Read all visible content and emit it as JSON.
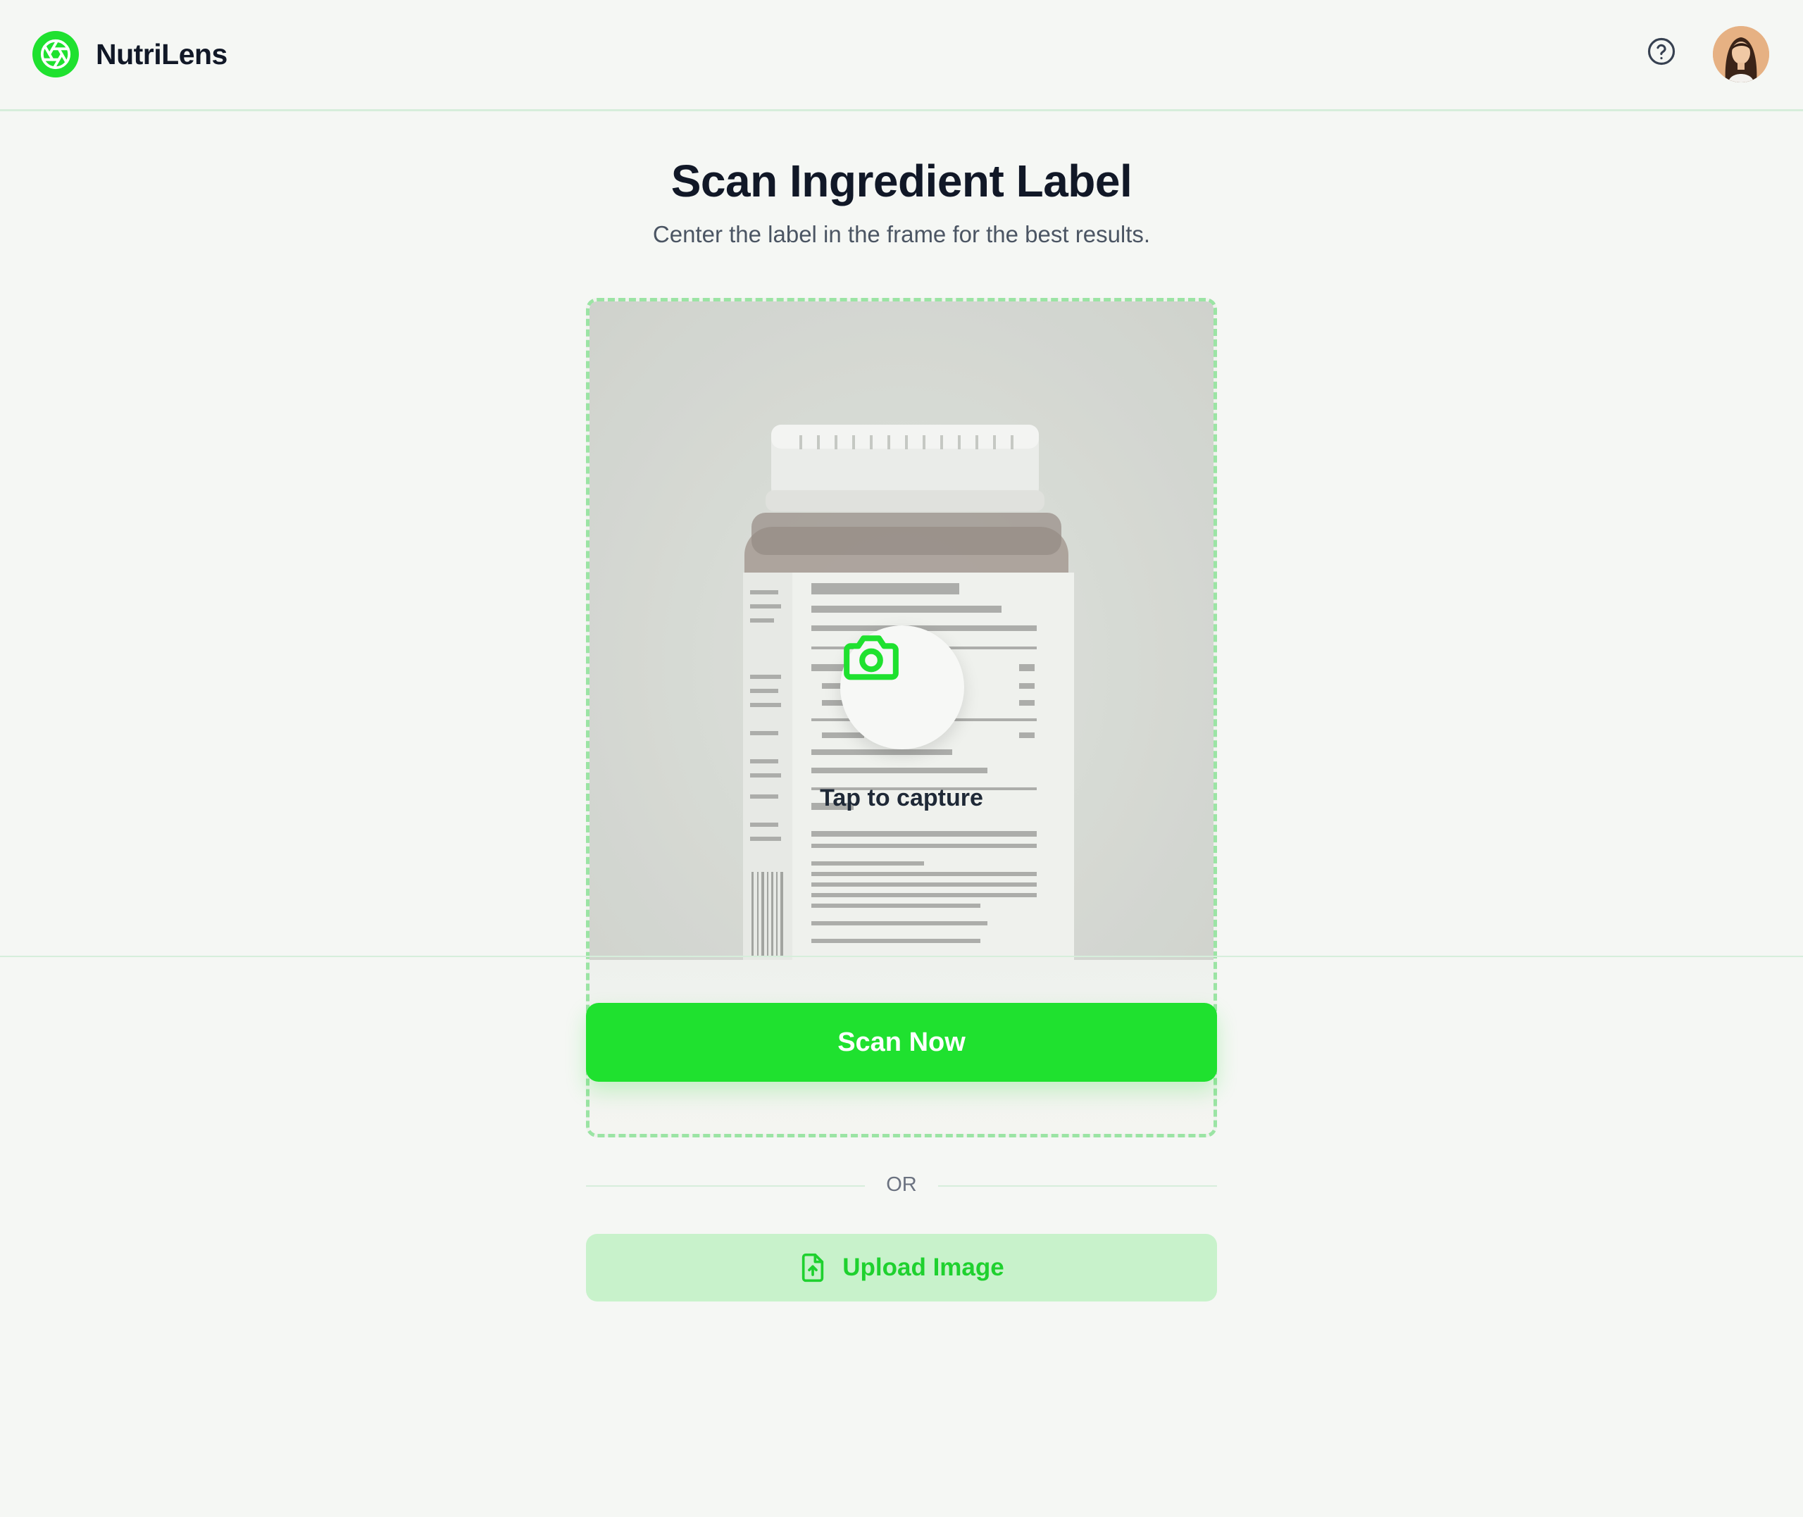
{
  "app": {
    "name": "NutriLens"
  },
  "header": {
    "help_icon": "help-circle-icon",
    "avatar_icon": "user-avatar"
  },
  "main": {
    "title": "Scan Ingredient Label",
    "subtitle": "Center the label in the frame for the best results.",
    "camera": {
      "capture_label": "Tap to capture",
      "capture_icon": "camera-icon"
    },
    "scan_button_label": "Scan Now",
    "divider_text": "OR",
    "upload_button_label": "Upload Image",
    "upload_icon": "file-upload-icon"
  },
  "colors": {
    "accent": "#1fe12f",
    "accent_soft": "#c8f2cb",
    "frame_border": "#9be4a4",
    "background": "#f5f7f4",
    "text_primary": "#111827",
    "text_secondary": "#4b5563"
  }
}
